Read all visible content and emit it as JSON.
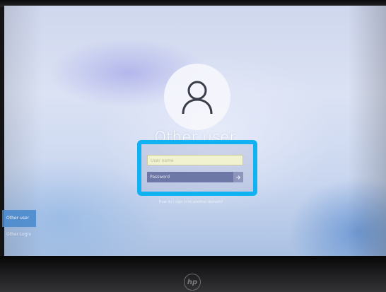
{
  "login": {
    "user_icon": "user-icon",
    "title": "Other user",
    "username_placeholder": "User name",
    "password_placeholder": "Password",
    "submit_icon": "arrow-right-icon",
    "help_link": "How do I sign in to another domain?"
  },
  "sidebar": {
    "items": [
      {
        "label": "Other user",
        "selected": true
      },
      {
        "label": "Other Login",
        "selected": false
      }
    ]
  },
  "device": {
    "logo_text": "hp"
  },
  "colors": {
    "highlight": "#10b2f2",
    "selected_item": "#4687cd",
    "password_field": "#6e78a6"
  }
}
